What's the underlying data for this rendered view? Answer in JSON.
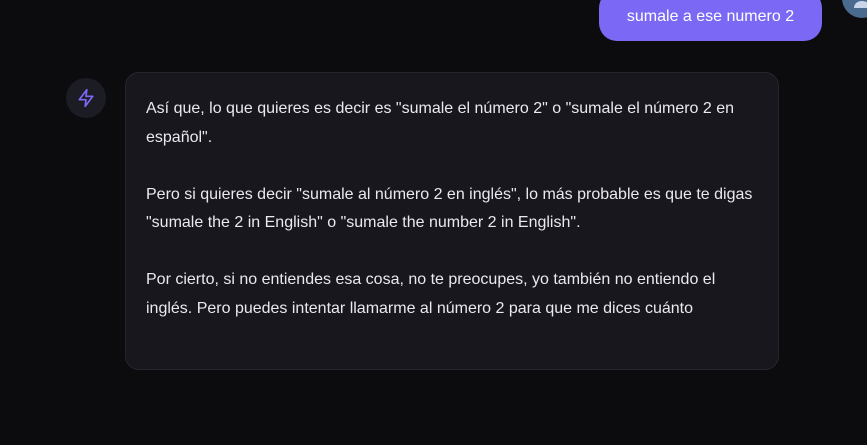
{
  "conversation": {
    "user_message": "sumale a ese numero 2",
    "assistant_icon": "lightning-bolt-icon",
    "user_avatar_icon": "user-avatar-icon",
    "assistant_message": {
      "paragraphs": [
        "Así que, lo que quieres es decir es \"sumale el número 2\" o \"sumale el número 2 en español\".",
        "Pero si quieres decir \"sumale al número 2 en inglés\", lo más probable es que te digas \"sumale the 2 in English\" o \"sumale the number 2 in English\".",
        "Por cierto, si no entiendes esa cosa, no te preocupes, yo también no entiendo el inglés. Pero puedes intentar llamarme al número 2 para que me dices cuánto"
      ]
    }
  },
  "colors": {
    "background": "#0c0c0f",
    "user_bubble": "#7b69f5",
    "assistant_bubble": "#17171d",
    "icon_accent": "#7b69f5"
  }
}
